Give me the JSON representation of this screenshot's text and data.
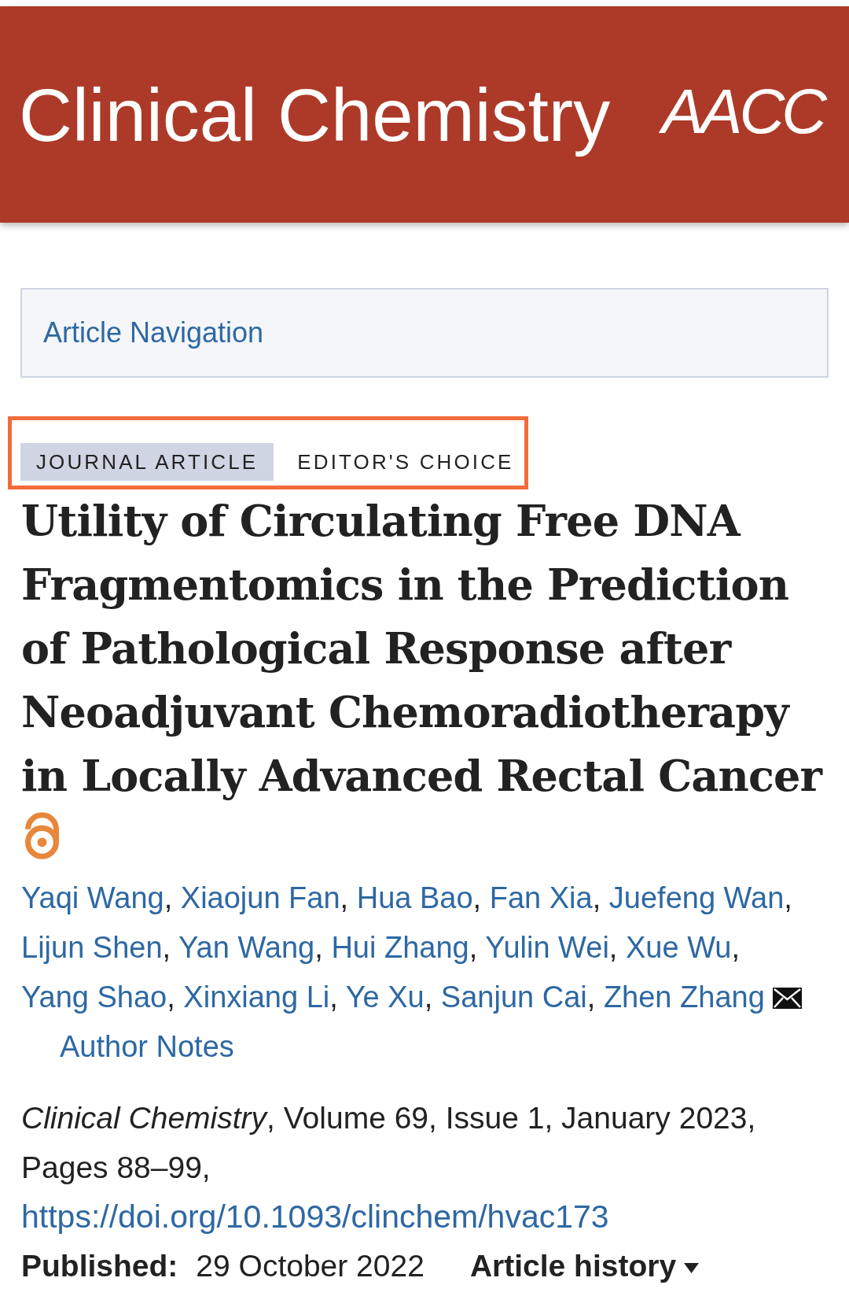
{
  "header": {
    "journal_logo": "Clinical Chemistry",
    "society_logo": "AACC"
  },
  "article_navigation": {
    "label": "Article Navigation"
  },
  "tags": {
    "highlighted": true,
    "items": [
      {
        "label": "JOURNAL ARTICLE",
        "kind": "type"
      },
      {
        "label": "EDITOR'S CHOICE",
        "kind": "category"
      }
    ]
  },
  "article": {
    "title": "Utility of Circulating Free DNA Fragmentomics in the Prediction of Pathological Response after Neoadjuvant Chemoradiotherapy in Locally Advanced Rectal Cancer",
    "open_access": true,
    "author_separator": ",",
    "authors": [
      {
        "name": "Yaqi Wang",
        "corresponding": false
      },
      {
        "name": "Xiaojun Fan",
        "corresponding": false
      },
      {
        "name": "Hua Bao",
        "corresponding": false
      },
      {
        "name": "Fan Xia",
        "corresponding": false
      },
      {
        "name": "Juefeng Wan",
        "corresponding": false
      },
      {
        "name": "Lijun Shen",
        "corresponding": false
      },
      {
        "name": "Yan Wang",
        "corresponding": false
      },
      {
        "name": "Hui Zhang",
        "corresponding": false
      },
      {
        "name": "Yulin Wei",
        "corresponding": false
      },
      {
        "name": "Xue Wu",
        "corresponding": false
      },
      {
        "name": "Yang Shao",
        "corresponding": false
      },
      {
        "name": "Xinxiang Li",
        "corresponding": false
      },
      {
        "name": "Ye Xu",
        "corresponding": false
      },
      {
        "name": "Sanjun Cai",
        "corresponding": false
      },
      {
        "name": "Zhen Zhang",
        "corresponding": true
      }
    ],
    "author_notes": "Author Notes"
  },
  "citation": {
    "text": "*Clinical Chemistry*, Volume 69, Issue 1, January 2023, Pages 88–99,",
    "doi": "https://doi.org/10.1093/clinchem/hvac173"
  },
  "published": {
    "label": "Published:",
    "date": "29 October 2022"
  },
  "article_history": {
    "label": "Article history",
    "expanded": false
  }
}
